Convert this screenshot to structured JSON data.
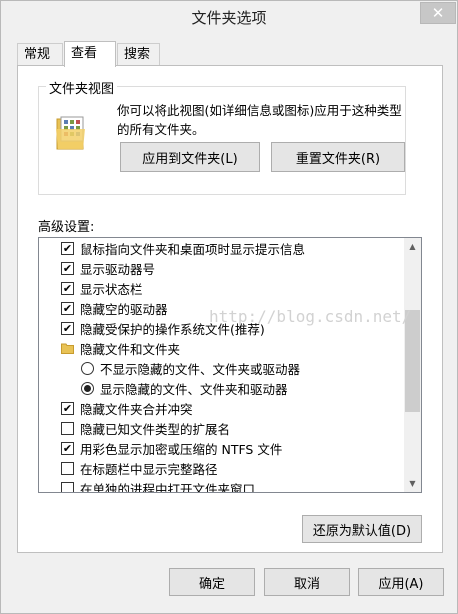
{
  "window": {
    "title": "文件夹选项"
  },
  "tabs": [
    {
      "label": "常规",
      "active": false
    },
    {
      "label": "查看",
      "active": true
    },
    {
      "label": "搜索",
      "active": false
    }
  ],
  "folder_views": {
    "group_title": "文件夹视图",
    "description": "你可以将此视图(如详细信息或图标)应用于这种类型的所有文件夹。",
    "apply_button": "应用到文件夹(L)",
    "reset_button": "重置文件夹(R)"
  },
  "advanced": {
    "label": "高级设置:",
    "items": [
      {
        "kind": "checkbox",
        "checked": true,
        "label": "鼠标指向文件夹和桌面项时显示提示信息"
      },
      {
        "kind": "checkbox",
        "checked": true,
        "label": "显示驱动器号"
      },
      {
        "kind": "checkbox",
        "checked": true,
        "label": "显示状态栏"
      },
      {
        "kind": "checkbox",
        "checked": true,
        "label": "隐藏空的驱动器"
      },
      {
        "kind": "checkbox",
        "checked": true,
        "label": "隐藏受保护的操作系统文件(推荐)"
      },
      {
        "kind": "folder",
        "checked": false,
        "label": "隐藏文件和文件夹"
      },
      {
        "kind": "radio",
        "checked": false,
        "label": "不显示隐藏的文件、文件夹或驱动器"
      },
      {
        "kind": "radio",
        "checked": true,
        "label": "显示隐藏的文件、文件夹和驱动器"
      },
      {
        "kind": "checkbox",
        "checked": true,
        "label": "隐藏文件夹合并冲突"
      },
      {
        "kind": "checkbox",
        "checked": false,
        "label": "隐藏已知文件类型的扩展名"
      },
      {
        "kind": "checkbox",
        "checked": true,
        "label": "用彩色显示加密或压缩的 NTFS 文件"
      },
      {
        "kind": "checkbox",
        "checked": false,
        "label": "在标题栏中显示完整路径"
      },
      {
        "kind": "checkbox",
        "checked": false,
        "label": "在单独的进程中打开文件夹窗口"
      }
    ],
    "restore_button": "还原为默认值(D)"
  },
  "watermark": "http://blog.csdn.net/",
  "footer": {
    "ok": "确定",
    "cancel": "取消",
    "apply": "应用(A)"
  },
  "colors": {
    "button_face": "#e5e5e5",
    "dialog_bg": "#f0f0f0",
    "check_mark": "#000000"
  }
}
